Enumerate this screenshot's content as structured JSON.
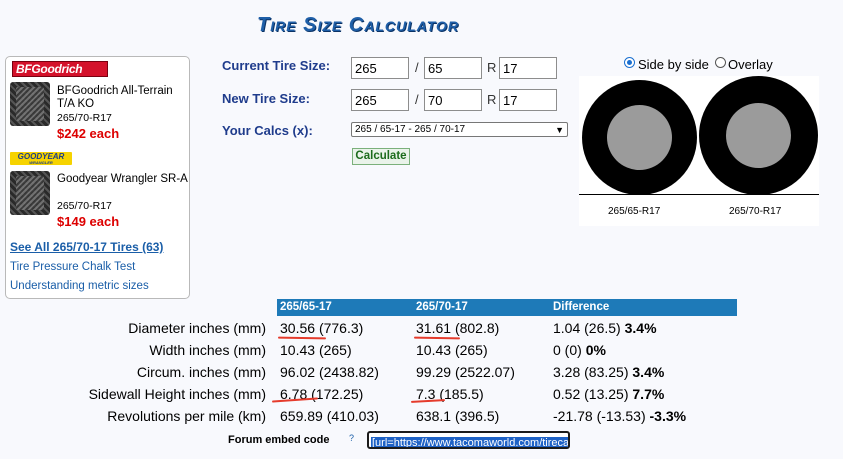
{
  "title": "Tire Size Calculator",
  "sidebar": {
    "ads": [
      {
        "brand": "BFGoodrich",
        "name": "BFGoodrich All-Terrain T/A KO",
        "size": "265/70-R17",
        "price": "$242 each"
      },
      {
        "brand": "GOODYEAR",
        "brand_sub": "WRANGLER",
        "name": "Goodyear Wrangler SR-A",
        "size": "265/70-R17",
        "price": "$149 each"
      }
    ],
    "see_all": "See All 265/70-17 Tires (63)",
    "links": [
      "Tire Pressure Chalk Test",
      "Understanding metric sizes"
    ]
  },
  "form": {
    "current_label": "Current Tire Size:",
    "new_label": "New Tire Size:",
    "calcs_label": "Your Calcs (x):",
    "current": {
      "width": "265",
      "aspect": "65",
      "rim": "17"
    },
    "new": {
      "width": "265",
      "aspect": "70",
      "rim": "17"
    },
    "slash": "/",
    "r": "R",
    "calcs_selected": "265 / 65-17 - 265 / 70-17",
    "calculate": "Calculate"
  },
  "visual": {
    "mode_side": "Side by side",
    "mode_overlay": "Overlay",
    "selected_mode": "side",
    "left_label": "265/65-R17",
    "right_label": "265/70-R17",
    "colors": {
      "tire": "#000000",
      "rim": "#9b9b9b"
    }
  },
  "results": {
    "headers": [
      "265/65-17",
      "265/70-17",
      "Difference"
    ],
    "rows": [
      {
        "label": "Diameter inches (mm)",
        "a": "30.56",
        "a_mm": "(776.3)",
        "b": "31.61",
        "b_mm": "(802.8)",
        "diff": "1.04 (26.5)",
        "pct": "3.4%"
      },
      {
        "label": "Width inches (mm)",
        "a": "10.43",
        "a_mm": "(265)",
        "b": "10.43",
        "b_mm": "(265)",
        "diff": "0 (0)",
        "pct": "0%"
      },
      {
        "label": "Circum. inches (mm)",
        "a": "96.02",
        "a_mm": "(2438.82)",
        "b": "99.29",
        "b_mm": "(2522.07)",
        "diff": "3.28 (83.25)",
        "pct": "3.4%"
      },
      {
        "label": "Sidewall Height inches (mm)",
        "a": "6.78",
        "a_mm": "(172.25)",
        "b": "7.3",
        "b_mm": "(185.5)",
        "diff": "0.52 (13.25)",
        "pct": "7.7%"
      },
      {
        "label": "Revolutions per mile (km)",
        "a": "659.89",
        "a_mm": "(410.03)",
        "b": "638.1",
        "b_mm": "(396.5)",
        "diff": "-21.78 (-13.53)",
        "pct": "-3.3%"
      }
    ],
    "annotation_color": "#e53b2c"
  },
  "embed": {
    "label": "Forum embed code",
    "help": "?",
    "value": "[url=https://www.tacomaworld.com/tireca"
  }
}
